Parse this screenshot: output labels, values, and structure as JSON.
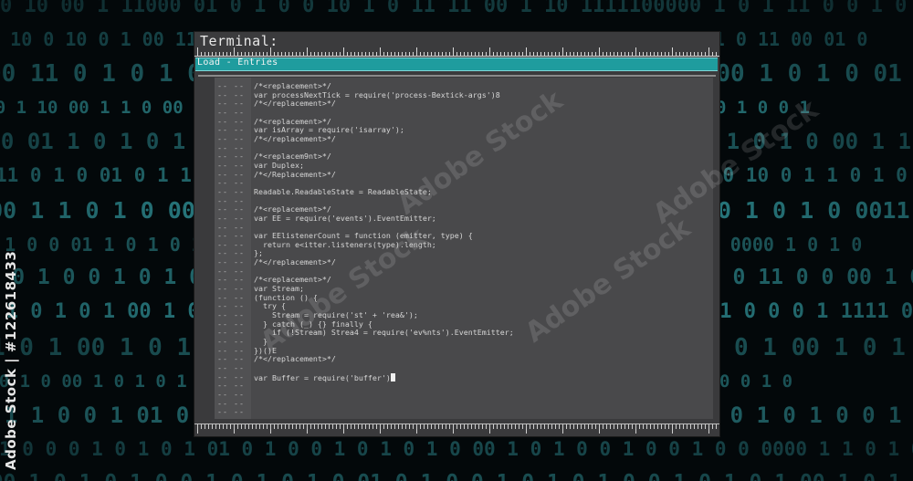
{
  "window": {
    "title": "Terminal:",
    "menu_label": "Load - Entries"
  },
  "code_lines": [
    {
      "ln": "-- --",
      "text": "/*<replacement>*/"
    },
    {
      "ln": "-- --",
      "text": "var processNextTick = require('process-Bextick-args')8"
    },
    {
      "ln": "-- --",
      "text": "/*</replacement>*/"
    },
    {
      "ln": "-- --",
      "text": ""
    },
    {
      "ln": "-- --",
      "text": "/*<replacement>*/"
    },
    {
      "ln": "-- --",
      "text": "var isArray = require('isarray');"
    },
    {
      "ln": "-- --",
      "text": "/*</replacement>*/"
    },
    {
      "ln": "-- --",
      "text": ""
    },
    {
      "ln": "-- --",
      "text": "/*<replacem9nt>*/"
    },
    {
      "ln": "-- --",
      "text": "var Duplex;"
    },
    {
      "ln": "-- --",
      "text": "/*</Replacement>*/"
    },
    {
      "ln": "-- --",
      "text": ""
    },
    {
      "ln": "-- --",
      "text": "Readable.ReadableState = ReadableState;"
    },
    {
      "ln": "-- --",
      "text": ""
    },
    {
      "ln": "-- --",
      "text": "/*<replacement>*/"
    },
    {
      "ln": "-- --",
      "text": "var EE = require('events').EventEmitter;"
    },
    {
      "ln": "-- --",
      "text": ""
    },
    {
      "ln": "-- --",
      "text": "var EElistenerCount = function (emitter, type) {"
    },
    {
      "ln": "-- --",
      "text": "  return e<itter.listeners(type).length;"
    },
    {
      "ln": "-- --",
      "text": "};"
    },
    {
      "ln": "-- --",
      "text": "/*</replacement>*/"
    },
    {
      "ln": "-- --",
      "text": ""
    },
    {
      "ln": "-- --",
      "text": "/*<replacement>*/"
    },
    {
      "ln": "-- --",
      "text": "var Stream;"
    },
    {
      "ln": "-- --",
      "text": "(function () {"
    },
    {
      "ln": "-- --",
      "text": "  try {"
    },
    {
      "ln": "-- --",
      "text": "    Stream = require('st' + 'rea&');"
    },
    {
      "ln": "-- --",
      "text": "  } catch (_) {} finally {"
    },
    {
      "ln": "-- --",
      "text": "    if (!Stream) Strea4 = require('ev%nts').EventEmitter;"
    },
    {
      "ln": "-- --",
      "text": "  }"
    },
    {
      "ln": "-- --",
      "text": "})()E"
    },
    {
      "ln": "-- --",
      "text": "/*</replacement>*/"
    },
    {
      "ln": "-- --",
      "text": ""
    },
    {
      "ln": "-- --",
      "text": "var Buffer = require('buffer')",
      "cursor": true
    },
    {
      "ln": "-- --",
      "text": ""
    },
    {
      "ln": "-- --",
      "text": ""
    },
    {
      "ln": "-- --",
      "text": ""
    },
    {
      "ln": "-- --",
      "text": ""
    }
  ],
  "background_binary": [
    "0 10 00 1 11000 01 0 1 0 0 10 1 0 11 11 00 1 10 1111100000 1 0 1 11 0 0 1 0 1 1",
    "1 1 10 0 10 0 1 00 11 0 0 10 10 0 0 1 0 0 10 1 01 0 10 0 1 00 11000 1 0 11 00 01 0",
    "00 11 0 1 0 1 0 01 0 1 0 1 00 1 0 01 0 1 0 0 1 0 1 00 1 0 1 0 01 1 0 1 0 10000 1 0",
    "1 0 0 1 10 00 1 1 0 00 1 0 01 1 0 0 1 1 0 1 00 1 01 0 1 0 01 0 1 1 0 0 1 0 1 0 0 1",
    "0 0 01 1 0 1 0 1 00 0 1 0 11 0 0 1 0 1 0 00 1 0 1 0 1 00 1 0 1 0 00 1 1 0 0 1 00",
    "11 0 1 0 01 0 1 1 0 1 0 0 01 1 0 00 1 0 1 0 1 0 01 1 0 0 1 0 1 0 10 0 1 1 0 1 0 0",
    "0 00 1 1 0 1 0 00 1 0 1 10 0 1 0 1 0 0 01 1 0 1 0 00 1 0 1 0 1 0 0011 0 1 0 1 0 1",
    "0 1 0 0 01 1 0 1 0 1 0 0 1 0 0 1 1 0 01 0 1 0 1 0 0 1 0 1 0 0 1 1 0 0000 1 0 1 0",
    "1 01 0 1 0 0 1 0 1 01 0 0 1 0 1 10 0 1 0 1 0 0 1 01 0 1 0 0 1 0 11 0 0 00 1 0 1 0",
    "00 1 0 1 0 1 00 1 0 0 1 0 1 0 1 00 1 0 1 0 01 0 1 0 0 1 0 1 0 1 0 0 0 1 1111 0 01",
    "1 0 1 00 1 0 1 0 1 0 01 0 1 0 0 1 0 1 0 1 0 0 1 0 1 0 1 00 1 0 1 0 1 0 0 01 1 0 1",
    "0 1 0 1 0 00 1 0 1 0 1 0 0 1 1 0 1 0 01 0 1 0 1 0 0 1 0 1 0 0 1 0 1 0 11 0 0 1 0",
    "0 1 1 0 0 1 01 0 1 0 0 1 0 1 0 1 0 00 1 0 1 0 1 0 0 1 01 0 1 0 1 0 0 1 0 1 0 1 0",
    "1 0 0 0 1 0 1 0 1 01 0 1 0 0 1 0 1 0 1 0 00 1 0 1 0 0 1 0 0 1 0 0 0000 1 1 0 1 0",
    "0 00 1 0 1 0 1 0 0 1 0 1 0 1 0 01 0 1 0 0 1 0 1 0 1 0 0 1 0 1 0 1 00 1 0 1 0 1 1"
  ],
  "watermark": {
    "side_text": "Adobe Stock | #122618433",
    "diag_text": "Adobe Stock"
  }
}
